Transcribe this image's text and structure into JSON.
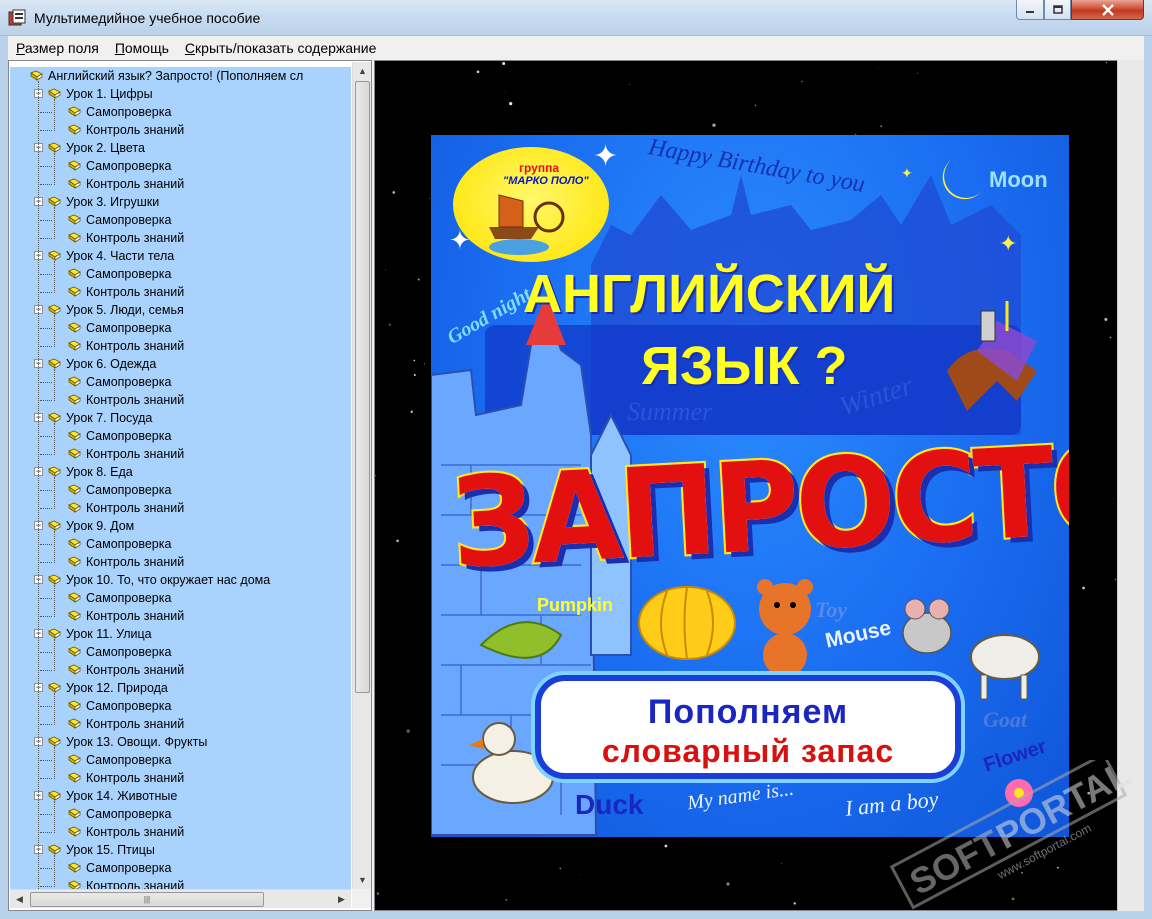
{
  "window": {
    "title": "Мультимедийное учебное пособие"
  },
  "menu": {
    "items": [
      {
        "label": "Размер поля",
        "underline": "Р",
        "rest": "азмер поля"
      },
      {
        "label": "Помощь",
        "underline": "П",
        "rest": "омощь"
      },
      {
        "label": "Скрыть/показать содержание",
        "underline": "С",
        "rest": "крыть/показать содержание"
      }
    ]
  },
  "tree": {
    "root": "Английский язык? Запросто! (Пополняем сл",
    "lessons": [
      {
        "label": "Урок 1. Цифры",
        "children": [
          "Самопроверка",
          "Контроль знаний"
        ]
      },
      {
        "label": "Урок 2. Цвета",
        "children": [
          "Самопроверка",
          "Контроль знаний"
        ]
      },
      {
        "label": "Урок 3. Игрушки",
        "children": [
          "Самопроверка",
          "Контроль знаний"
        ]
      },
      {
        "label": "Урок 4. Части тела",
        "children": [
          "Самопроверка",
          "Контроль знаний"
        ]
      },
      {
        "label": "Урок 5. Люди, семья",
        "children": [
          "Самопроверка",
          "Контроль знаний"
        ]
      },
      {
        "label": "Урок 6. Одежда",
        "children": [
          "Самопроверка",
          "Контроль знаний"
        ]
      },
      {
        "label": "Урок 7. Посуда",
        "children": [
          "Самопроверка",
          "Контроль знаний"
        ]
      },
      {
        "label": "Урок 8. Еда",
        "children": [
          "Самопроверка",
          "Контроль знаний"
        ]
      },
      {
        "label": "Урок 9. Дом",
        "children": [
          "Самопроверка",
          "Контроль знаний"
        ]
      },
      {
        "label": "Урок 10. То, что окружает нас дома",
        "children": [
          "Самопроверка",
          "Контроль знаний"
        ]
      },
      {
        "label": "Урок 11. Улица",
        "children": [
          "Самопроверка",
          "Контроль знаний"
        ]
      },
      {
        "label": "Урок 12. Природа",
        "children": [
          "Самопроверка",
          "Контроль знаний"
        ]
      },
      {
        "label": "Урок 13. Овощи. Фрукты",
        "children": [
          "Самопроверка",
          "Контроль знаний"
        ]
      },
      {
        "label": "Урок 14. Животные",
        "children": [
          "Самопроверка",
          "Контроль знаний"
        ]
      },
      {
        "label": "Урок 15. Птицы",
        "children": [
          "Самопроверка",
          "Контроль знаний"
        ]
      }
    ]
  },
  "cover": {
    "publisher_label": "группа",
    "publisher_name": "\"МАРКО ПОЛО\"",
    "title_line1": "АНГЛИЙСКИЙ",
    "title_line2": "ЯЗЫК ?",
    "title_big": "ЗАПРОСТО!",
    "subtitle_line1": "Пополняем",
    "subtitle_line2": "словарный запас",
    "words": {
      "happy_birthday": "Happy Birthday to you",
      "moon": "Moon",
      "good_night": "Good night",
      "summer": "Summer",
      "winter": "Winter",
      "pumpkin": "Pumpkin",
      "toy": "Toy",
      "mouse": "Mouse",
      "goat": "Goat",
      "flower": "Flower",
      "duck": "Duck",
      "my_name_is": "My name is...",
      "i_am_a_boy": "I am a boy"
    }
  },
  "watermark": {
    "brand": "PORTAL",
    "prefix": "SOFT",
    "site": "www.softportal.com",
    "tm": "TM"
  },
  "colors": {
    "tree_bg": "#a9d3fd",
    "cover_blue": "#1a6cf0",
    "title_yellow": "#ffff22",
    "big_red": "#e31010"
  }
}
